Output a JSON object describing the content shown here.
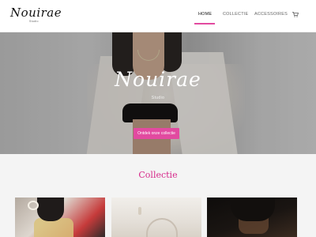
{
  "brand": {
    "name": "Nouirae",
    "subtitle": "Studio"
  },
  "nav": {
    "items": [
      {
        "label": "HOME",
        "active": true
      },
      {
        "label": "COLLECTIE",
        "active": false
      },
      {
        "label": "ACCESSOIRES",
        "active": false
      }
    ],
    "cart_icon": "shopping-cart-icon"
  },
  "hero": {
    "title": "Nouirae",
    "subtitle": "Studio",
    "cta_label": "Ontdek onze collectie"
  },
  "collection": {
    "title": "Collectie"
  },
  "colors": {
    "accent": "#e24aa0",
    "title": "#d6298a"
  }
}
